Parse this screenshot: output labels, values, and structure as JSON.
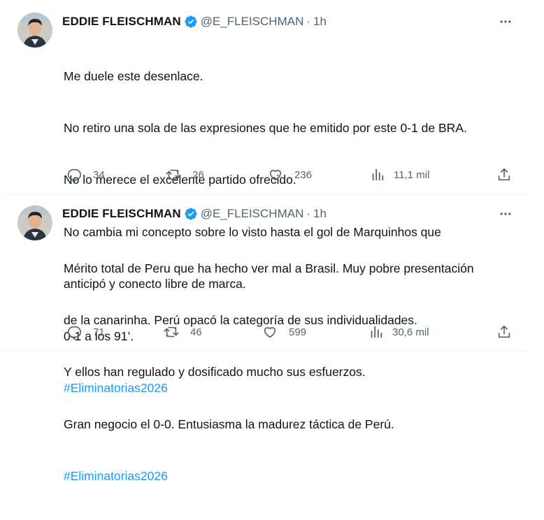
{
  "tweets": [
    {
      "name": "EDDIE FLEISCHMAN",
      "handle": "@E_FLEISCHMAN",
      "dot": "·",
      "time": "1h",
      "lines": [
        "Me duele este desenlace.",
        "No retiro una sola de las expresiones que he emitido por este 0-1 de BRA.",
        "No lo merece el excelente partido ofrecido.",
        "No cambia mi concepto sobre lo visto hasta el gol de Marquinhos que",
        "anticipó y conecto libre de marca.",
        "0-1 a los 91’."
      ],
      "hashtag": "#Eliminatorias2026",
      "stats": {
        "replies": "34",
        "retweets": "26",
        "likes": "236",
        "views": "11,1 mil"
      }
    },
    {
      "name": "EDDIE FLEISCHMAN",
      "handle": "@E_FLEISCHMAN",
      "dot": "·",
      "time": "1h",
      "lines": [
        "Mérito total de Peru que ha hecho ver mal a Brasil. Muy pobre presentación",
        "de la canarinha. Perú opacó la categoría de sus individualidades.",
        "Y ellos han regulado y dosificado mucho sus esfuerzos.",
        "Gran negocio el 0-0. Entusiasma la madurez táctica de Perú."
      ],
      "hashtag": "#Eliminatorias2026",
      "stats": {
        "replies": "71",
        "retweets": "46",
        "likes": "599",
        "views": "30,6 mil"
      }
    }
  ],
  "colors": {
    "accent": "#1d9bf0",
    "muted": "#536471",
    "text": "#0f1419"
  },
  "icons": [
    "verified-badge-icon",
    "more-icon",
    "reply-icon",
    "retweet-icon",
    "like-icon",
    "views-icon",
    "share-icon"
  ]
}
